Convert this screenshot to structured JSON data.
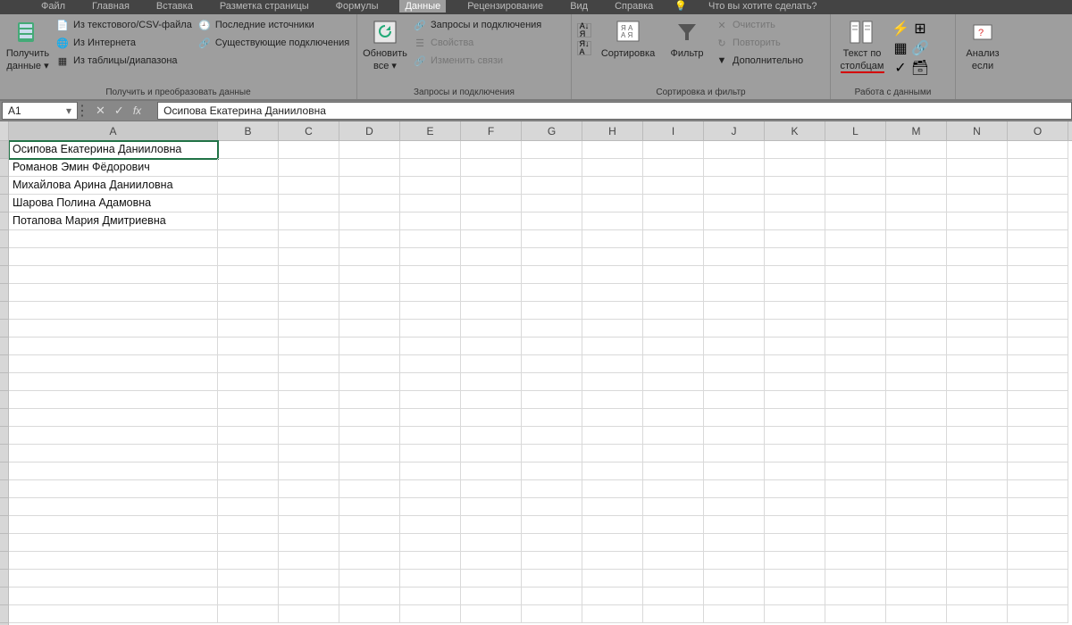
{
  "tabs": {
    "items": [
      "Файл",
      "Главная",
      "Вставка",
      "Разметка страницы",
      "Формулы",
      "Данные",
      "Рецензирование",
      "Вид",
      "Справка"
    ],
    "tell_me": "Что вы хотите сделать?",
    "active": "Данные"
  },
  "ribbon": {
    "group1": {
      "big": {
        "line1": "Получить",
        "line2": "данные"
      },
      "items": [
        "Из текстового/CSV-файла",
        "Из Интернета",
        "Из таблицы/диапазона",
        "Последние источники",
        "Существующие подключения"
      ],
      "label": "Получить и преобразовать данные"
    },
    "group2": {
      "big": {
        "line1": "Обновить",
        "line2": "все"
      },
      "items": [
        "Запросы и подключения",
        "Свойства",
        "Изменить связи"
      ],
      "label": "Запросы и подключения"
    },
    "group3": {
      "sort": "Сортировка",
      "filter": "Фильтр",
      "clear": "Очистить",
      "reapply": "Повторить",
      "advanced": "Дополнительно",
      "label": "Сортировка и фильтр"
    },
    "group4": {
      "text_to_columns": {
        "line1": "Текст по",
        "line2": "столбцам"
      },
      "label": "Работа с данными"
    },
    "group5": {
      "whatif": {
        "line1": "Анализ",
        "line2": "если"
      }
    }
  },
  "formula_bar": {
    "namebox": "A1",
    "value": "Осипова Екатерина Данииловна"
  },
  "columns": [
    "A",
    "B",
    "C",
    "D",
    "E",
    "F",
    "G",
    "H",
    "I",
    "J",
    "K",
    "L",
    "M",
    "N",
    "O"
  ],
  "cells": {
    "a1": "Осипова Екатерина Данииловна",
    "a2": "Романов Эмин Фёдорович",
    "a3": "Михайлова Арина Данииловна",
    "a4": "Шарова Полина Адамовна",
    "a5": "Потапова Мария Дмитриевна"
  }
}
